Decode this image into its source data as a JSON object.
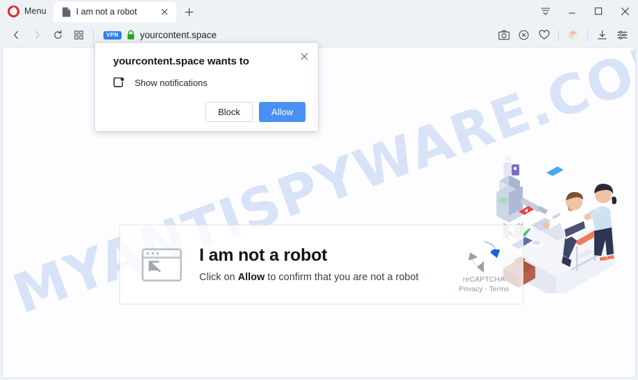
{
  "browser": {
    "name": "Opera",
    "menu_label": "Menu",
    "logo_color": "#e3242b",
    "tab": {
      "title": "I am not a robot",
      "favicon": "page-icon",
      "close": "close-icon"
    },
    "new_tab": "+",
    "window_controls": [
      {
        "name": "tab-menu",
        "glyph": "tab-menu-icon"
      },
      {
        "name": "minimize",
        "glyph": "minimize-icon"
      },
      {
        "name": "maximize",
        "glyph": "maximize-icon"
      },
      {
        "name": "close",
        "glyph": "close-icon"
      }
    ],
    "nav": {
      "back": "back-icon",
      "forward": "forward-icon",
      "reload": "reload-icon",
      "speed_dial": "grid-icon"
    },
    "address": {
      "vpn_badge": "VPN",
      "vpn_color": "#2e7ff0",
      "lock": "padlock-icon",
      "lock_color": "#2aa02a",
      "url": "yourcontent.space"
    },
    "toolbar_icons": [
      {
        "name": "snapshot-icon"
      },
      {
        "name": "adblock-icon"
      },
      {
        "name": "heart-icon"
      },
      {
        "name": "extension-cube-icon"
      },
      {
        "name": "downloads-icon"
      },
      {
        "name": "easy-setup-icon"
      }
    ]
  },
  "notification_dialog": {
    "title": "yourcontent.space wants to",
    "permission": "Show notifications",
    "permission_icon": "notification-bell-icon",
    "close_icon": "close-icon",
    "block_label": "Block",
    "allow_label": "Allow",
    "allow_color": "#4a90f4"
  },
  "page": {
    "heading_prefix": "Click on ",
    "heading_highlight": "Allow",
    "heading_suffix": " to confirm",
    "watermark": "MYANTISPYWARE.COM",
    "watermark_color": "#78a0e1",
    "captcha": {
      "window_icon": "browser-window-cursor-icon",
      "title": "I am not a robot",
      "subtitle_prefix": "Click on ",
      "subtitle_bold": "Allow",
      "subtitle_suffix": " to confirm that you are not a robot",
      "recaptcha_logo": "recaptcha-icon",
      "recaptcha_name": "reCAPTCHA",
      "recaptcha_terms": "Privacy - Terms"
    },
    "illustration": "office-robot-desk-illustration"
  }
}
